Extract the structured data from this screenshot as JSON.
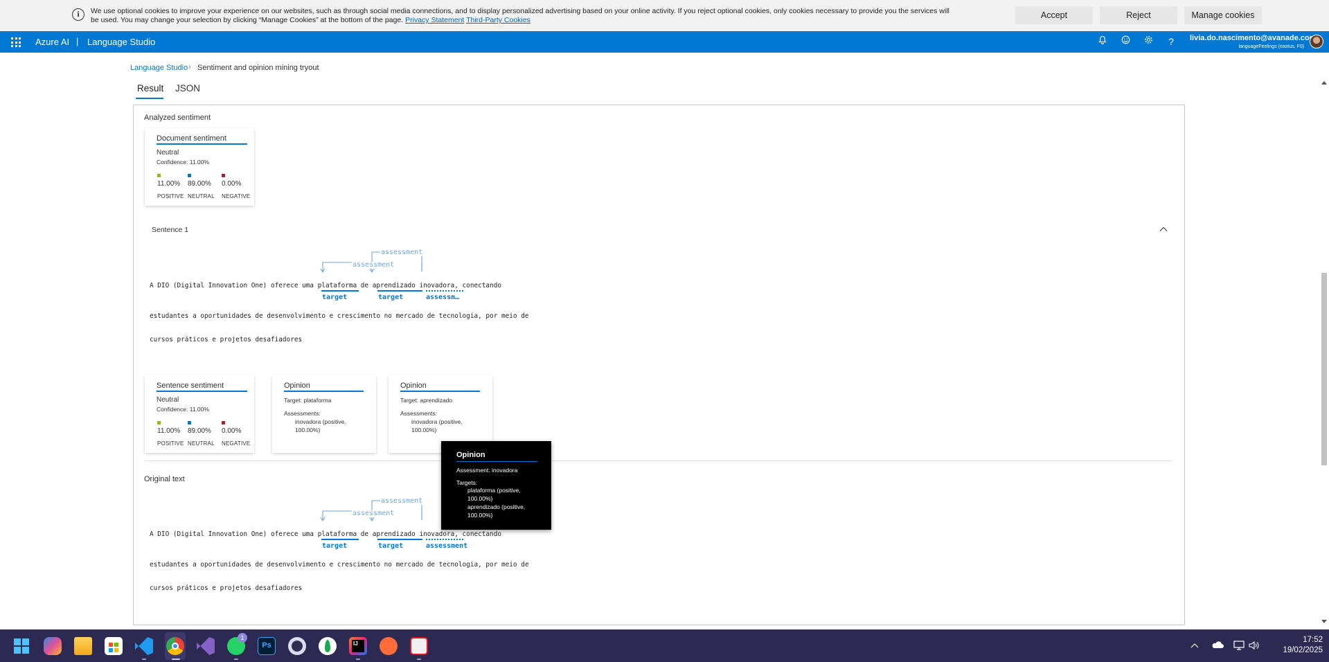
{
  "cookie_banner": {
    "message": "We use optional cookies to improve your experience on our websites, such as through social media connections, and to display personalized advertising based on your online activity. If you reject optional cookies, only cookies necessary to provide you the services will be used. You may change your selection by clicking “Manage Cookies” at the bottom of the page.",
    "privacy_link": "Privacy Statement",
    "third_party_link": "Third-Party Cookies",
    "accept": "Accept",
    "reject": "Reject",
    "manage": "Manage cookies"
  },
  "topbar": {
    "brand": "Azure AI",
    "separator": "|",
    "product": "Language Studio",
    "user_email": "livia.do.nascimento@avanade.com",
    "user_resource": "languageFeelings (eastus, F0)"
  },
  "breadcrumb": {
    "root": "Language Studio",
    "current": "Sentiment and opinion mining tryout"
  },
  "tabs": {
    "result": "Result",
    "json": "JSON"
  },
  "analyzed": {
    "title": "Analyzed sentiment",
    "document_card": {
      "title": "Document sentiment",
      "label": "Neutral",
      "confidence": "Confidence: 11.00%",
      "scores": [
        {
          "pct": "11.00%",
          "name": "POSITIVE",
          "color": "#8cbd18"
        },
        {
          "pct": "89.00%",
          "name": "NEUTRAL",
          "color": "#0078d4"
        },
        {
          "pct": "0.00%",
          "name": "NEGATIVE",
          "color": "#a4262c"
        }
      ]
    },
    "sentence": {
      "header": "Sentence 1",
      "lines": [
        "A DIO (Digital Innovation One) oferece uma plataforma de aprendizado inovadora, conectando",
        "estudantes a oportunidades de desenvolvimento e crescimento no mercado de tecnologia, por meio de",
        "cursos práticos e projetos desafiadores"
      ],
      "labels": {
        "target1": "target",
        "target2": "target",
        "assessment": "assessm…",
        "arc1": "assessment",
        "arc2": "assessment"
      }
    },
    "sentence_card": {
      "title": "Sentence sentiment",
      "label": "Neutral",
      "confidence": "Confidence: 11.00%",
      "scores": [
        {
          "pct": "11.00%",
          "name": "POSITIVE",
          "color": "#8cbd18"
        },
        {
          "pct": "89.00%",
          "name": "NEUTRAL",
          "color": "#0078d4"
        },
        {
          "pct": "0.00%",
          "name": "NEGATIVE",
          "color": "#a4262c"
        }
      ]
    },
    "opinions": [
      {
        "title": "Opinion",
        "target": "Target: plataforma",
        "assessments_label": "Assessments:",
        "assessment": "inovadora (positive, 100.00%)"
      },
      {
        "title": "Opinion",
        "target": "Target: aprendizado",
        "assessments_label": "Assessments:",
        "assessment": "inovadora (positive, 100.00%)"
      }
    ]
  },
  "original": {
    "title": "Original text",
    "labels": {
      "target1": "target",
      "target2": "target",
      "assessment": "assessment",
      "arc1": "assessment",
      "arc2": "assessment"
    }
  },
  "tooltip": {
    "title": "Opinion",
    "assessment": "Assessment: inovadora",
    "targets_label": "Targets:",
    "target1": "plataforma (positive, 100.00%)",
    "target2": "aprendizado (positive, 100.00%)"
  },
  "taskbar": {
    "time": "17:52",
    "date": "19/02/2025",
    "whatsapp_badge": "1",
    "apps": [
      "windows-start",
      "copilot",
      "file-explorer",
      "microsoft-store",
      "vscode",
      "chrome",
      "visual-studio",
      "whatsapp",
      "photoshop",
      "obs",
      "mongodb-compass",
      "intellij",
      "postman",
      "snipping-tool"
    ]
  },
  "colors": {
    "accent": "#0078d4",
    "taskbar": "#2c2a52",
    "cookie_bg": "#f2f2f2"
  }
}
